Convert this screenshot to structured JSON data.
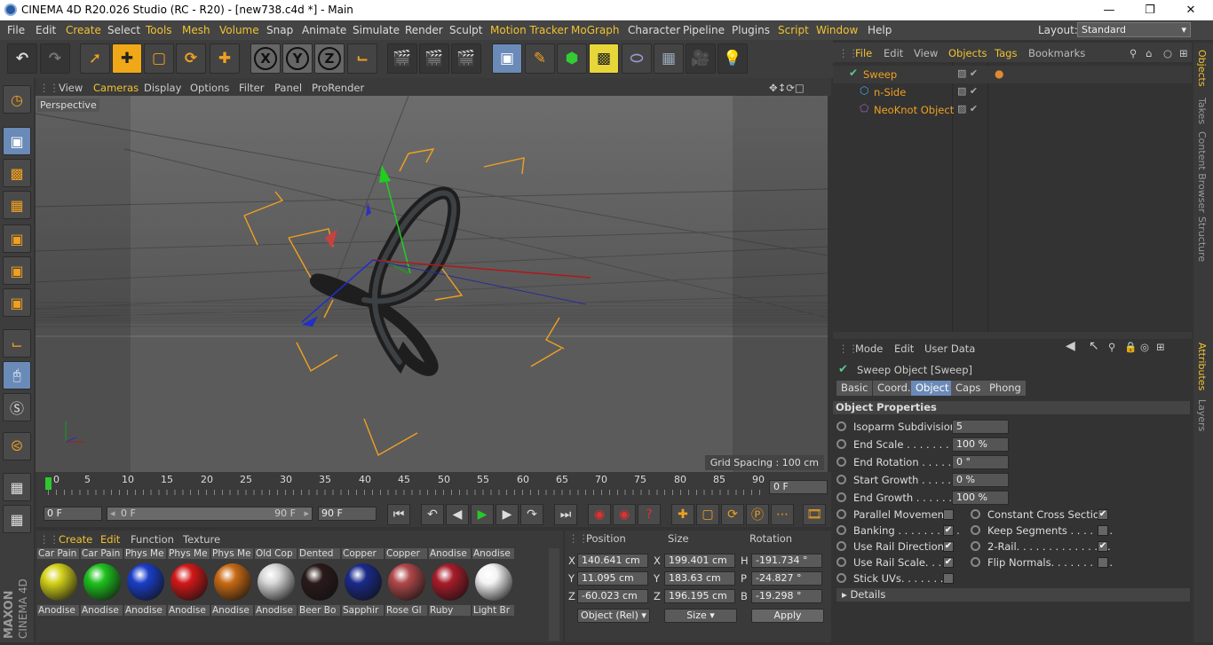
{
  "window": {
    "title": "CINEMA 4D R20.026 Studio (RC - R20) - [new738.c4d *] - Main"
  },
  "menubar": {
    "items": [
      "File",
      "Edit",
      "Create",
      "Select",
      "Tools",
      "Mesh",
      "Volume",
      "Snap",
      "Animate",
      "Simulate",
      "Render",
      "Sculpt",
      "Motion Tracker",
      "MoGraph",
      "Character",
      "Pipeline",
      "Plugins",
      "Script",
      "Window",
      "Help"
    ],
    "layout_label": "Layout:",
    "layout_value": "Standard"
  },
  "toolbar": {
    "icons": [
      "undo-icon",
      "redo-icon",
      "live-selection-icon",
      "move-icon",
      "scale-icon",
      "rotate-icon",
      "recent-tool-icon",
      "x-axis-icon",
      "y-axis-icon",
      "z-axis-icon",
      "coordinate-system-icon",
      "render-view-icon",
      "render-to-picture-viewer-icon",
      "edit-render-settings-icon",
      "cube-icon",
      "pen-icon",
      "subdivision-icon",
      "extrude-icon",
      "deformer-icon",
      "floor-icon",
      "camera-icon",
      "light-icon"
    ],
    "axis": {
      "x": "X",
      "y": "Y",
      "z": "Z"
    }
  },
  "viewport": {
    "menu": [
      "View",
      "Cameras",
      "Display",
      "Options",
      "Filter",
      "Panel",
      "ProRender"
    ],
    "label": "Perspective",
    "grid_spacing": "Grid Spacing : 100 cm"
  },
  "timeline": {
    "ticks": [
      "0",
      "5",
      "10",
      "15",
      "20",
      "25",
      "30",
      "35",
      "40",
      "45",
      "50",
      "55",
      "60",
      "65",
      "70",
      "75",
      "80",
      "85",
      "90"
    ],
    "current_frame": "0 F",
    "start_field": "0 F",
    "range_start": "0 F",
    "range_end": "90 F",
    "end_field": "90 F"
  },
  "materials": {
    "tabs": [
      "Create",
      "Edit",
      "Function",
      "Texture"
    ],
    "items": [
      {
        "top": "Car Pain",
        "bottom": "Anodise",
        "color": "#d4d21a"
      },
      {
        "top": "Car Pain",
        "bottom": "Anodise",
        "color": "#1ec21e"
      },
      {
        "top": "Phys Me",
        "bottom": "Anodise",
        "color": "#1a3ec8"
      },
      {
        "top": "Phys Me",
        "bottom": "Anodise",
        "color": "#d21818"
      },
      {
        "top": "Phys Me",
        "bottom": "Anodise",
        "color": "#c86a14"
      },
      {
        "top": "Old Cop",
        "bottom": "Anodise",
        "color": "#d8d8d8"
      },
      {
        "top": "Dented",
        "bottom": "Beer Bo",
        "color": "#2a1a1a"
      },
      {
        "top": "Copper",
        "bottom": "Sapphir",
        "color": "#1a2a8a"
      },
      {
        "top": "Copper",
        "bottom": "Rose Gl",
        "color": "#b0484a"
      },
      {
        "top": "Anodise",
        "bottom": "Ruby",
        "color": "#a81c2a"
      },
      {
        "top": "Anodise",
        "bottom": "Light Br",
        "color": "#f4f4f4"
      }
    ]
  },
  "coords": {
    "headers": {
      "position": "Position",
      "size": "Size",
      "rotation": "Rotation"
    },
    "rows": [
      {
        "axis": "X",
        "pos": "140.641 cm",
        "saxis": "X",
        "size": "199.401 cm",
        "raxis": "H",
        "rot": "-191.734 °"
      },
      {
        "axis": "Y",
        "pos": "11.095 cm",
        "saxis": "Y",
        "size": "183.63 cm",
        "raxis": "P",
        "rot": "-24.827 °"
      },
      {
        "axis": "Z",
        "pos": "-60.023 cm",
        "saxis": "Z",
        "size": "196.195 cm",
        "raxis": "B",
        "rot": "-19.298 °"
      }
    ],
    "mode": "Object (Rel)",
    "size_mode": "Size",
    "apply": "Apply"
  },
  "objects": {
    "menu": [
      "File",
      "Edit",
      "View",
      "Objects",
      "Tags",
      "Bookmarks"
    ],
    "items": [
      {
        "name": "Sweep",
        "depth": 0,
        "icon": "sweep-icon"
      },
      {
        "name": "n-Side",
        "depth": 1,
        "icon": "n-side-spline-icon"
      },
      {
        "name": "NeoKnot Object",
        "depth": 1,
        "icon": "knot-spline-icon"
      }
    ]
  },
  "attributes": {
    "menu": [
      "Mode",
      "Edit",
      "User Data"
    ],
    "title": "Sweep Object [Sweep]",
    "tabs": [
      "Basic",
      "Coord.",
      "Object",
      "Caps",
      "Phong"
    ],
    "active_tab": "Object",
    "section": "Object Properties",
    "fields": [
      {
        "label": "Isoparm Subdivision",
        "value": "5"
      },
      {
        "label": "End Scale . . . . . . . . .",
        "value": "100 %"
      },
      {
        "label": "End Rotation . . . . . .",
        "value": "0 °"
      },
      {
        "label": "Start Growth . . . . . .",
        "value": "0 %"
      },
      {
        "label": "End Growth . . . . . . .",
        "value": "100 %"
      }
    ],
    "checks_left": [
      {
        "label": "Parallel Movement",
        "checked": false
      },
      {
        "label": "Banking . . . . . . . . . .",
        "checked": true
      },
      {
        "label": "Use Rail Direction",
        "checked": true
      },
      {
        "label": "Use Rail Scale. . . .",
        "checked": true
      },
      {
        "label": "Stick UVs. . . . . . . .",
        "checked": false
      }
    ],
    "checks_right": [
      {
        "label": "Constant Cross Section",
        "checked": true
      },
      {
        "label": "Keep Segments . . . . . . .",
        "checked": false
      },
      {
        "label": "2-Rail. . . . . . . . . . . . . . .",
        "checked": true
      },
      {
        "label": "Flip Normals. . . . . . . . . .",
        "checked": false
      }
    ],
    "details": "Details"
  },
  "right_tabs_top": [
    "Objects",
    "Takes",
    "Content Browser",
    "Structure"
  ],
  "right_tabs_bottom": [
    "Attributes",
    "Layers"
  ],
  "branding": {
    "maxon": "MAXON",
    "product": "CINEMA 4D"
  },
  "colors": {
    "accent": "#f1c232",
    "orange": "#f0a020",
    "active_blue": "#6a8ab8"
  }
}
